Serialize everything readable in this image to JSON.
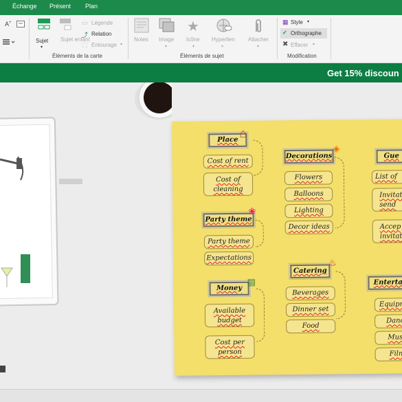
{
  "tabs": [
    "Échange",
    "Présent",
    "Plan"
  ],
  "ribbon": {
    "map_elements": {
      "sujet": "Sujet",
      "sujet_enfant": "Sujet enfant",
      "legende": "Légende",
      "relation": "Relation",
      "entourage": "Entourage",
      "group_label": "Éléments de la carte"
    },
    "subject_elements": {
      "notes": "Notes",
      "image": "Image",
      "icone": "Icône",
      "hyperlien": "Hyperlien",
      "attacher": "Attacher",
      "group_label": "Éléments de sujet"
    },
    "modification": {
      "style": "Style",
      "orthographe": "Orthographe",
      "effacer": "Effacer",
      "group_label": "Modification"
    }
  },
  "banner": {
    "text": "Get 15% discoun"
  },
  "mindmap": {
    "place": {
      "title": "Place",
      "items": [
        "Cost of rent",
        "Cost of cleaning"
      ]
    },
    "party_theme": {
      "title": "Party theme",
      "items": [
        "Party theme",
        "Expectations"
      ]
    },
    "money": {
      "title": "Money",
      "items": [
        "Available budget",
        "Cost per person"
      ]
    },
    "decorations": {
      "title": "Decorations",
      "items": [
        "Flowers",
        "Balloons",
        "Lighting",
        "Decor ideas"
      ]
    },
    "catering": {
      "title": "Catering",
      "items": [
        "Beverages",
        "Dinner set",
        "Food"
      ]
    },
    "guests": {
      "title": "Gue",
      "items": [
        "List of",
        "Invitati send",
        "Accep invitati"
      ]
    },
    "entertainment": {
      "title": "Entertai",
      "items": [
        "Equipm",
        "Danc",
        "Musi",
        "Film"
      ]
    }
  },
  "colors": {
    "ribbon_green": "#1b8a4a",
    "banner_green": "#0d7d43",
    "note_yellow": "#f3df6a"
  }
}
